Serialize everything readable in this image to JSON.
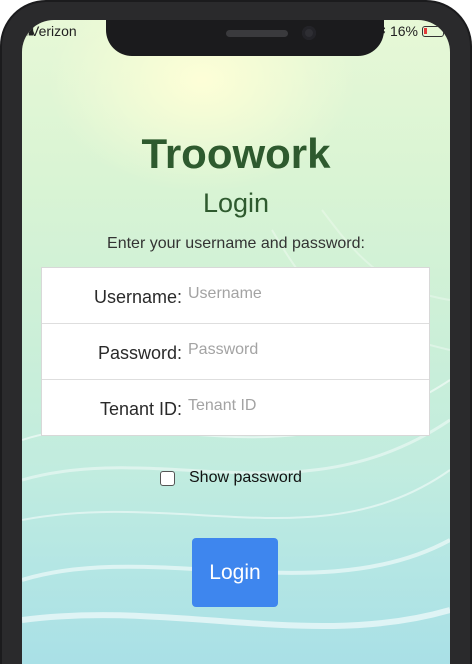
{
  "status_bar": {
    "carrier": "Verizon",
    "battery": "16%"
  },
  "brand": "Troowork",
  "page_title": "Login",
  "instructions": "Enter your username and password:",
  "form": {
    "username_label": "Username:",
    "username_placeholder": "Username",
    "password_label": "Password:",
    "password_placeholder": "Password",
    "tenant_label": "Tenant ID:",
    "tenant_placeholder": "Tenant ID"
  },
  "show_password_label": "Show password",
  "show_password_checked": false,
  "login_button_label": "Login",
  "colors": {
    "brand_text": "#2e5a2e",
    "button": "#3e86ee",
    "battery_low": "#e23b3b"
  }
}
